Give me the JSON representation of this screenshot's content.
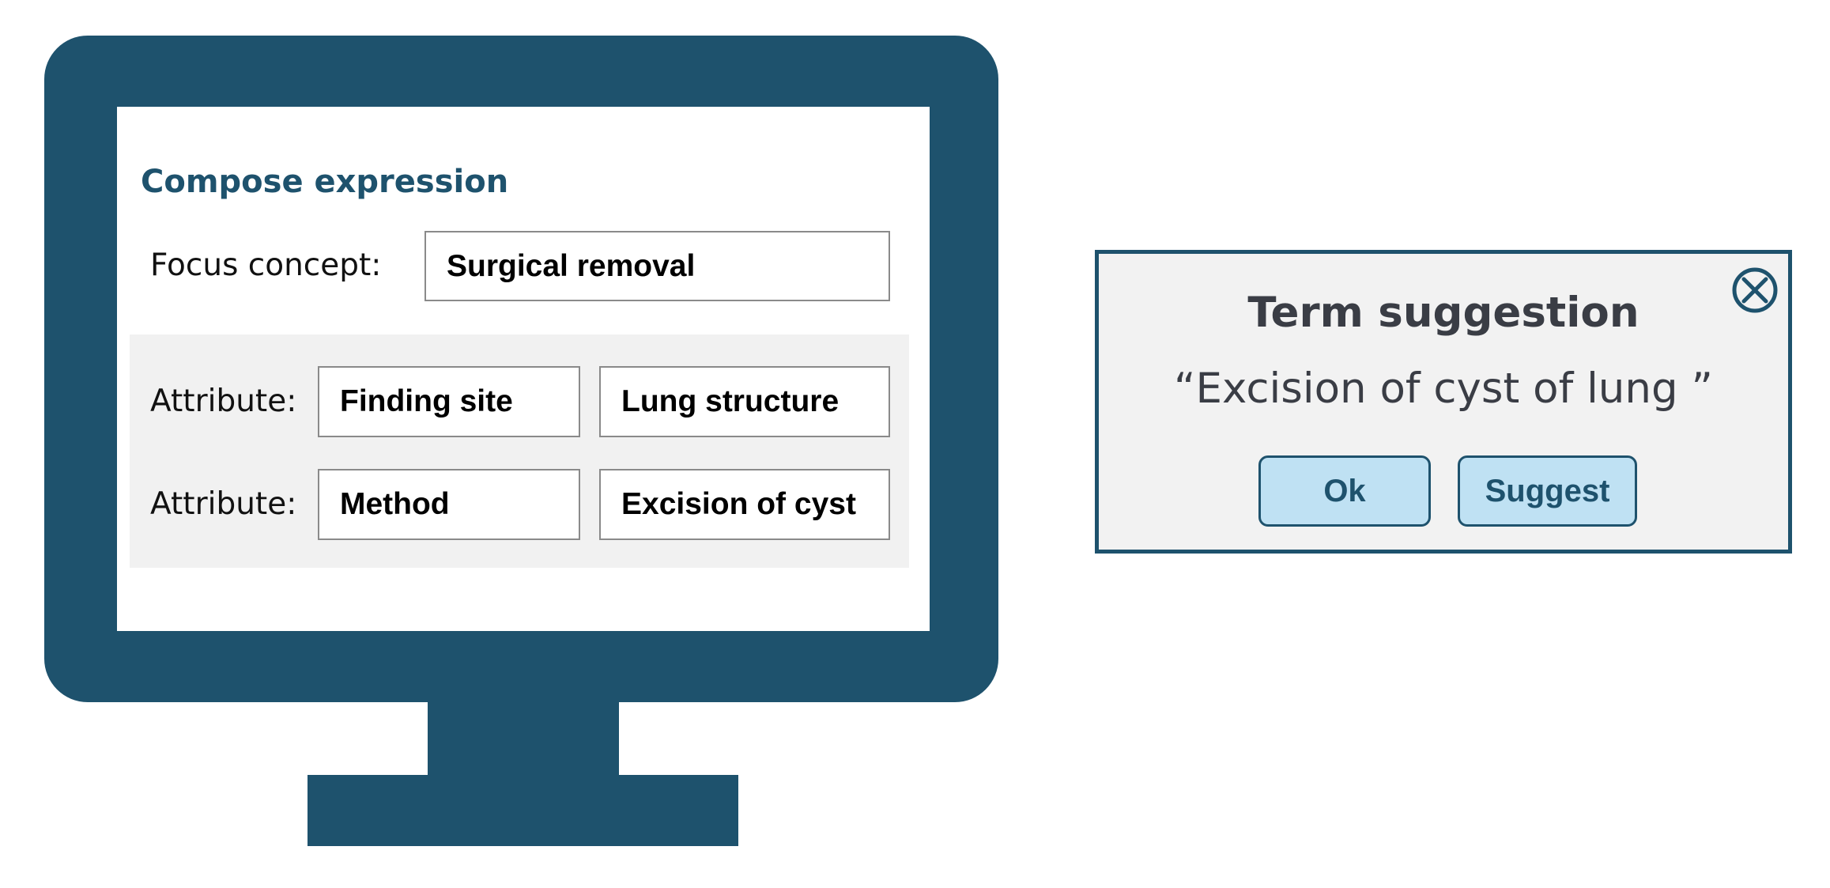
{
  "compose": {
    "title": "Compose expression",
    "focus_label": "Focus concept:",
    "focus_value": "Surgical removal",
    "attributes": [
      {
        "label": "Attribute:",
        "name": "Finding site",
        "value": "Lung structure"
      },
      {
        "label": "Attribute:",
        "name": "Method",
        "value": "Excision of cyst"
      }
    ]
  },
  "dialog": {
    "title": "Term suggestion",
    "suggestion": "“Excision of cyst of lung ”",
    "ok_label": "Ok",
    "suggest_label": "Suggest",
    "close_icon": "close-circle-x-icon"
  },
  "colors": {
    "primary": "#1e526d",
    "button_fill": "#bfe1f3",
    "panel_bg": "#f1f1f1",
    "dialog_bg": "#f2f2f2"
  }
}
